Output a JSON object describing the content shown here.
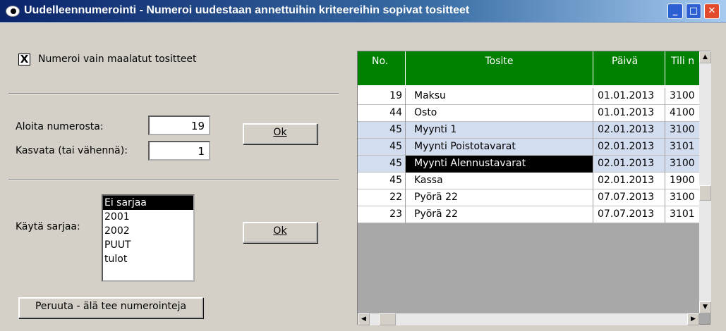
{
  "window": {
    "title": "Uudelleennumerointi - Numeroi uudestaan annettuihin kriteereihin sopivat tositteet"
  },
  "options": {
    "only_marked_label": "Numeroi vain maalatut tositteet",
    "only_marked_checked": "X"
  },
  "numbering": {
    "start_label": "Aloita numerosta:",
    "start_value": "19",
    "increment_label": "Kasvata (tai vähennä):",
    "increment_value": "1",
    "ok_label": "Ok"
  },
  "series": {
    "label": "Käytä sarjaa:",
    "options": [
      "Ei sarjaa",
      "2001",
      "2002",
      "PUUT",
      "tulot"
    ],
    "selected": "Ei sarjaa",
    "ok_label": "Ok"
  },
  "cancel_label": "Peruuta - älä tee numerointeja",
  "table": {
    "columns": [
      "No.",
      "Tosite",
      "Päivä",
      "Tili n"
    ],
    "rows": [
      {
        "no": "19",
        "tosite": "Maksu",
        "paiva": "01.01.2013",
        "tili": "3100",
        "highlight": false
      },
      {
        "no": "44",
        "tosite": "Osto",
        "paiva": "01.01.2013",
        "tili": "4100",
        "highlight": false
      },
      {
        "no": "45",
        "tosite": "Myynti 1",
        "paiva": "02.01.2013",
        "tili": "3100",
        "highlight": true
      },
      {
        "no": "45",
        "tosite": "Myynti Poistotavarat",
        "paiva": "02.01.2013",
        "tili": "3101",
        "highlight": true
      },
      {
        "no": "45",
        "tosite": "Myynti Alennustavarat",
        "paiva": "02.01.2013",
        "tili": "3100",
        "highlight": true
      },
      {
        "no": "45",
        "tosite": "Kassa",
        "paiva": "02.01.2013",
        "tili": "1900",
        "highlight": false
      },
      {
        "no": "22",
        "tosite": "Pyörä 22",
        "paiva": "07.07.2013",
        "tili": "3100",
        "highlight": false
      },
      {
        "no": "23",
        "tosite": "Pyörä 22",
        "paiva": "07.07.2013",
        "tili": "3101",
        "highlight": false
      }
    ]
  },
  "icons": {
    "app": "eye-icon",
    "minimize": "minimize-icon",
    "maximize": "maximize-icon",
    "close": "close-icon"
  },
  "colors": {
    "header_green": "#008000",
    "highlight_blue": "#d3ddf0",
    "title_blue": "#0a246a"
  }
}
